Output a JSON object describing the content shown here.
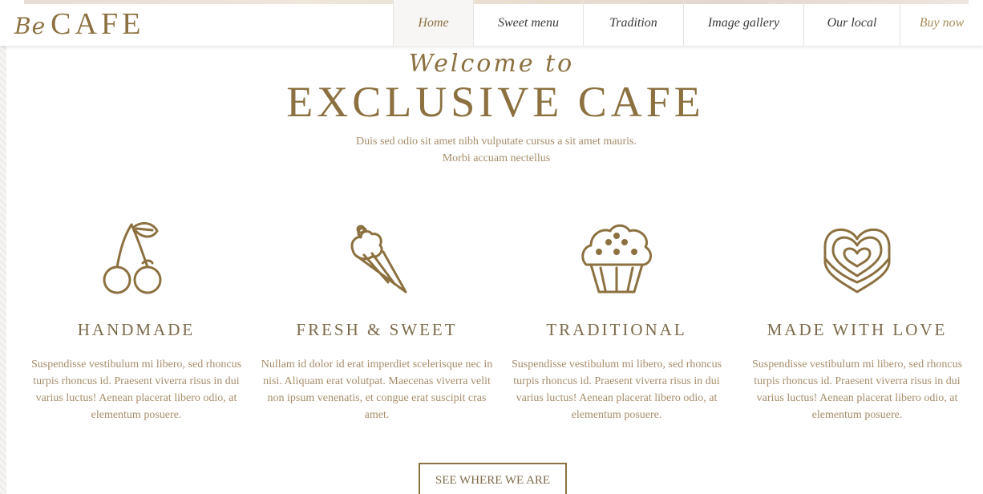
{
  "logo": {
    "script": "Be",
    "main": "CAFE"
  },
  "nav": {
    "items": [
      {
        "label": "Home",
        "active": true
      },
      {
        "label": "Sweet menu",
        "active": false
      },
      {
        "label": "Tradition",
        "active": false
      },
      {
        "label": "Image gallery",
        "active": false
      },
      {
        "label": "Our local",
        "active": false
      },
      {
        "label": "Buy now",
        "active": false
      }
    ]
  },
  "hero": {
    "welcome": "Welcome to",
    "title": "EXCLUSIVE CAFE",
    "lead_line1": "Duis sed odio sit amet nibh vulputate cursus a sit amet mauris.",
    "lead_line2": "Morbi accuam nectellus"
  },
  "features": [
    {
      "icon": "cherry-icon",
      "title": "HANDMADE",
      "text": "Suspendisse vestibulum mi libero, sed rhoncus turpis rhoncus id. Praesent viverra risus in dui varius luctus! Aenean placerat libero odio, at elementum posuere."
    },
    {
      "icon": "ice-cream-icon",
      "title": "FRESH & SWEET",
      "text": "Nullam id dolor id erat imperdiet scelerisque nec in nisi. Aliquam erat volutpat. Maecenas viverra velit non ipsum venenatis, et congue erat suscipit cras amet."
    },
    {
      "icon": "cupcake-icon",
      "title": "TRADITIONAL",
      "text": "Suspendisse vestibulum mi libero, sed rhoncus turpis rhoncus id. Praesent viverra risus in dui varius luctus! Aenean placerat libero odio, at elementum posuere."
    },
    {
      "icon": "heart-icon",
      "title": "MADE WITH LOVE",
      "text": "Suspendisse vestibulum mi libero, sed rhoncus turpis rhoncus id. Praesent viverra risus in dui varius luctus! Aenean placerat libero odio, at elementum posuere."
    }
  ],
  "cta": {
    "label": "SEE WHERE WE ARE"
  },
  "colors": {
    "brand": "#8c7040",
    "text_muted": "#a88d6a",
    "heading": "#7d6a4a",
    "nav_text": "#3a3a3a"
  }
}
